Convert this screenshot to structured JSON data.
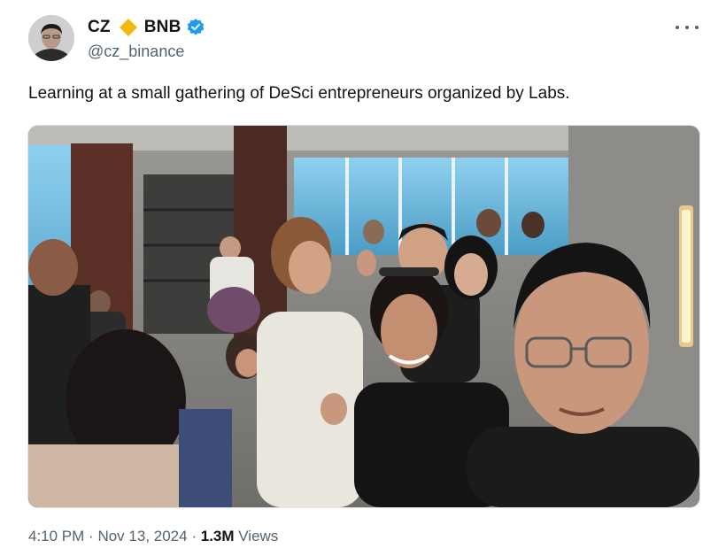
{
  "author": {
    "display_name_part1": "CZ",
    "display_name_part2": "BNB",
    "handle": "@cz_binance",
    "brand_color": "#f0b90b",
    "verified_color": "#1d9bf0"
  },
  "tweet": {
    "text": "Learning at a small gathering of DeSci entrepreneurs organized by Labs.",
    "time": "4:10 PM",
    "separator1": "·",
    "date": "Nov 13, 2024",
    "separator2": "·",
    "views_count": "1.3M",
    "views_label": "Views"
  },
  "icons": {
    "avatar": "avatar",
    "diamond": "bnb-diamond-icon",
    "verified": "verified-badge-icon",
    "more": "more-options-icon"
  }
}
